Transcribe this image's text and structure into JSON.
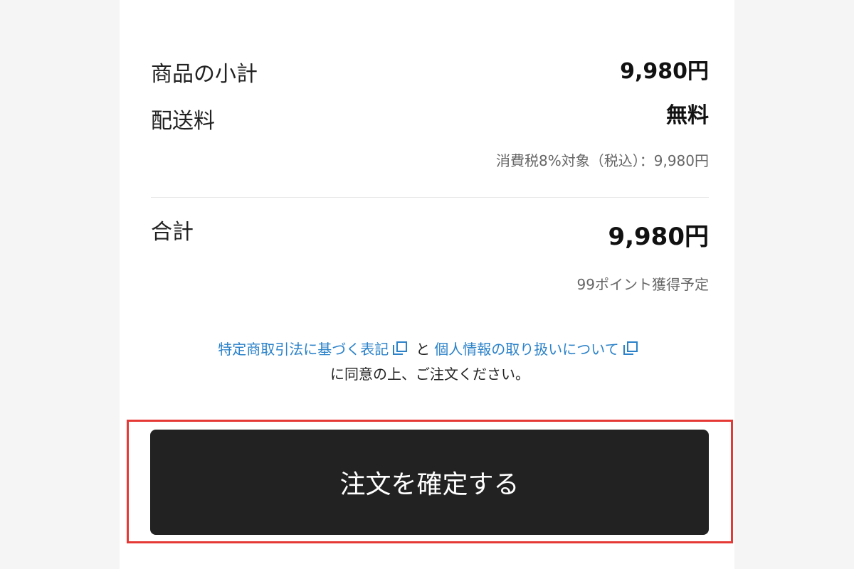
{
  "summary": {
    "subtotal_label": "商品の小計",
    "subtotal_value": "9,980円",
    "shipping_label": "配送料",
    "shipping_value": "無料",
    "tax_note": "消費税8%対象（税込）：9,980円",
    "total_label": "合計",
    "total_value": "9,980円",
    "points_note": "99ポイント獲得予定"
  },
  "agreement": {
    "link_law": "特定商取引法に基づく表記",
    "connector": "と",
    "link_privacy": "個人情報の取り扱いについて",
    "consent_text": "に同意の上、ご注文ください。"
  },
  "actions": {
    "confirm_label": "注文を確定する"
  },
  "colors": {
    "link": "#2b82c9",
    "button_bg": "#222222",
    "highlight": "#e53935"
  },
  "icons": {
    "external_link": "external-link-icon"
  }
}
